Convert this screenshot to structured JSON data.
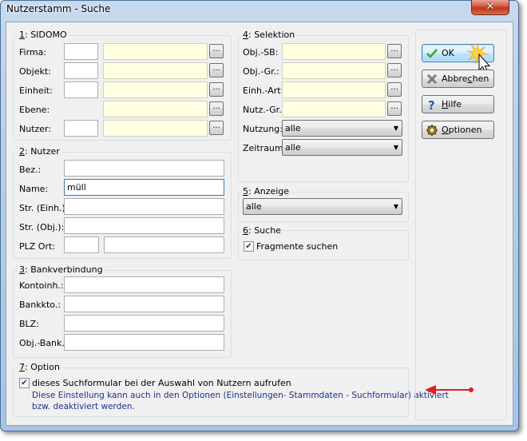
{
  "window": {
    "title": "Nutzerstamm - Suche",
    "close_glyph": "✕"
  },
  "sidomo": {
    "title_num": "1",
    "title_rest": ": SIDOMO",
    "rows": [
      {
        "label": "Firma:"
      },
      {
        "label": "Objekt:"
      },
      {
        "label": "Einheit:"
      },
      {
        "label": "Ebene:"
      },
      {
        "label": "Nutzer:"
      }
    ],
    "dots": "..."
  },
  "nutzer": {
    "title_num": "2",
    "title_rest": ": Nutzer",
    "bez_label": "Bez.:",
    "name_label": "Name:",
    "name_value": "müll",
    "str_einh_label": "Str. (Einh.):",
    "str_obj_label": "Str. (Obj.):",
    "plz_label": "PLZ Ort:"
  },
  "bank": {
    "title_num": "3",
    "title_rest": ": Bankverbindung",
    "kontoinh_label": "Kontoinh.:",
    "bankkto_label": "Bankkto.:",
    "blz_label": "BLZ:",
    "objbank_label": "Obj.-Bank.:"
  },
  "selektion": {
    "title_num": "4",
    "title_rest": ": Selektion",
    "rows": [
      {
        "label": "Obj.-SB:"
      },
      {
        "label": "Obj.-Gr.:"
      },
      {
        "label": "Einh.-Art:"
      },
      {
        "label": "Nutz.-Gr.:"
      }
    ],
    "nutzung_label": "Nutzung:",
    "nutzung_value": "alle",
    "zeitraum_label": "Zeitraum:",
    "zeitraum_value": "alle"
  },
  "anzeige": {
    "title_num": "5",
    "title_rest": ": Anzeige",
    "value": "alle"
  },
  "suche": {
    "title_num": "6",
    "title_rest": ": Suche",
    "fragmente_label": "Fragmente suchen",
    "fragmente_checked": true
  },
  "option": {
    "title_num": "7",
    "title_rest": ": Option",
    "checkbox_label": "dieses Suchformular bei der Auswahl von Nutzern aufrufen",
    "checked": true,
    "info_line1": "Diese Einstellung kann auch in den Optionen (Einstellungen- Stammdaten - Suchformular) aktiviert",
    "info_line2": "bzw. deaktiviert werden.",
    "info_color": "#1f2f8f"
  },
  "buttons": {
    "ok": "OK",
    "abbrechen_pre": "Abbre",
    "abbrechen_u": "c",
    "abbrechen_post": "hen",
    "hilfe_u": "H",
    "hilfe_post": "ilfe",
    "optionen_u": "O",
    "optionen_post": "ptionen"
  },
  "annotation": {
    "arrow_color": "#e02020"
  }
}
